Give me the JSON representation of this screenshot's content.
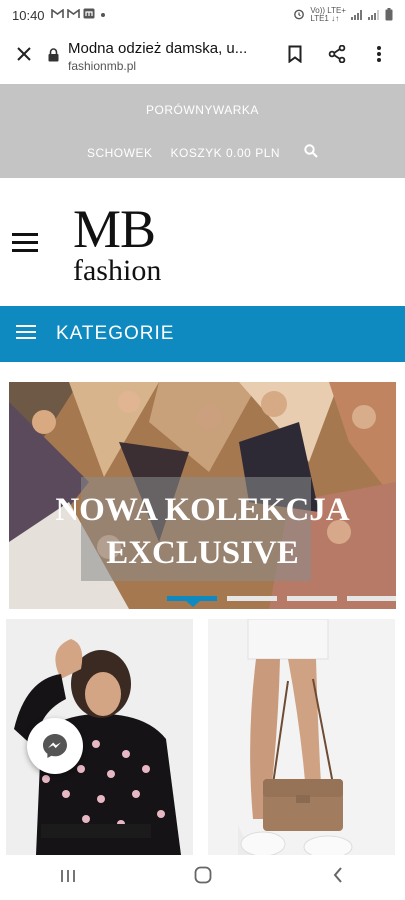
{
  "status_bar": {
    "time": "10:40",
    "notification_icons": [
      "gmail-icon",
      "gmail-icon",
      "app-icon",
      "dot"
    ],
    "network_label_top": "Vo)) LTE+",
    "network_label_bottom": "LTE1 ↓↑"
  },
  "browser": {
    "page_title": "Modna odzież damska, u...",
    "domain": "fashionmb.pl"
  },
  "site_header": {
    "compare_link": "PORÓWNYWARKA",
    "clipboard_link": "SCHOWEK",
    "cart_link": "KOSZYK 0.00 PLN"
  },
  "logo": {
    "line1": "MB",
    "line2": "fashion"
  },
  "category_bar": {
    "label": "KATEGORIE"
  },
  "banner": {
    "line1": "NOWA KOLEKCJA",
    "line2": "EXCLUSIVE",
    "slides_count": 4,
    "active_slide": 1
  },
  "colors": {
    "accent": "#0f8ac1",
    "top_bar": "#c4c4c4"
  }
}
